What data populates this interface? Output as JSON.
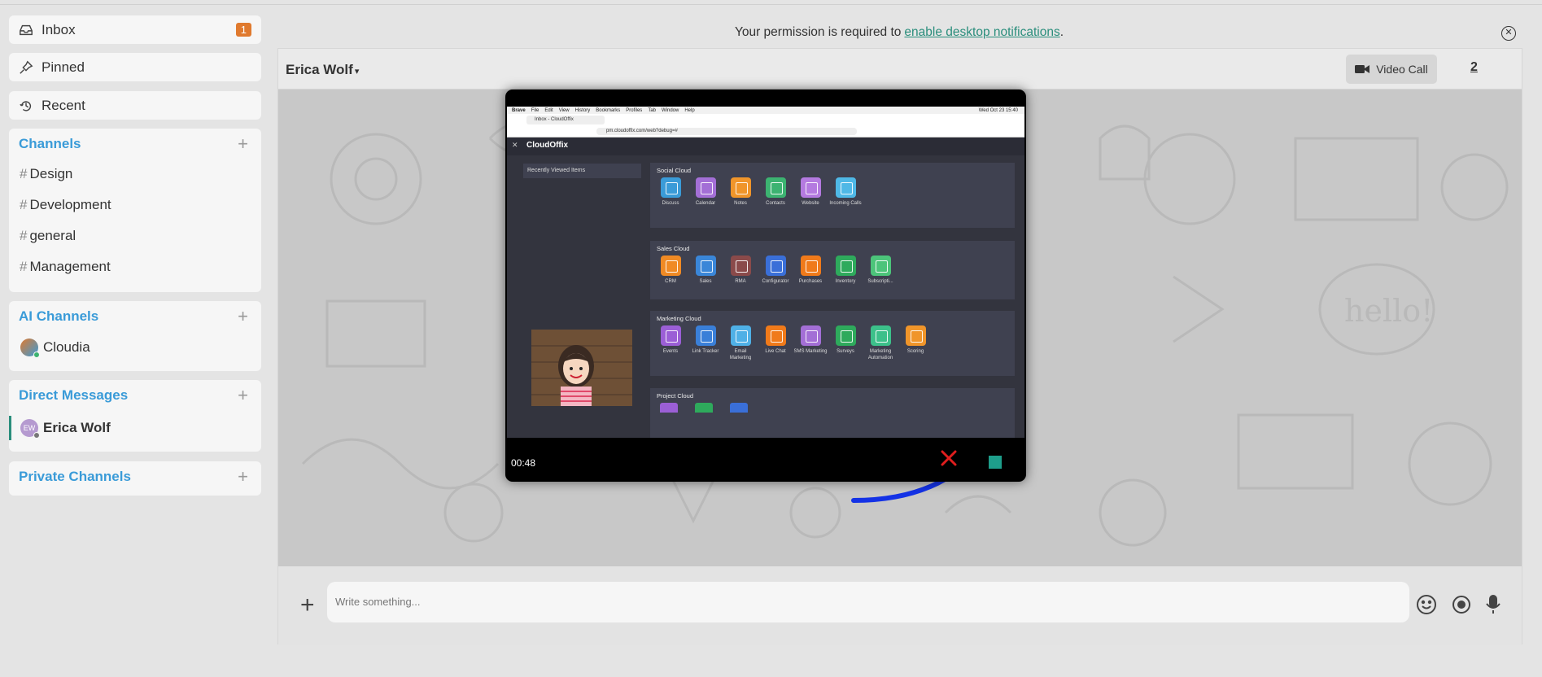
{
  "sidebar": {
    "inbox": {
      "label": "Inbox",
      "badge": "1"
    },
    "pinned": {
      "label": "Pinned"
    },
    "recent": {
      "label": "Recent"
    },
    "channels": {
      "title": "Channels",
      "items": [
        "Design",
        "Development",
        "general",
        "Management"
      ]
    },
    "ai_channels": {
      "title": "AI Channels",
      "items": [
        "Cloudia"
      ]
    },
    "direct_messages": {
      "title": "Direct Messages",
      "items": [
        {
          "name": "Erica Wolf",
          "initials": "EW"
        }
      ]
    },
    "private_channels": {
      "title": "Private Channels"
    }
  },
  "notification": {
    "text": "Your permission is required to",
    "link": "enable desktop notifications",
    "suffix": "."
  },
  "chat": {
    "contact_name": "Erica Wolf",
    "video_call_label": "Video Call",
    "participant_count": "2"
  },
  "video_overlay": {
    "timer": "00:48",
    "shared_screen": {
      "mac_menu": [
        "Brave",
        "File",
        "Edit",
        "View",
        "History",
        "Bookmarks",
        "Profiles",
        "Tab",
        "Window",
        "Help"
      ],
      "clock": "Wed Oct 23 15:40",
      "tab_title": "Inbox - CloudOffix",
      "url": "pm.cloudoffix.com/web?debug=#",
      "brand": "CloudOffix",
      "recently_viewed": "Recently Viewed Items",
      "sections": [
        {
          "title": "Social Cloud",
          "apps": [
            "Discuss",
            "Calendar",
            "Notes",
            "Contacts",
            "Website",
            "Incoming Calls"
          ]
        },
        {
          "title": "Sales Cloud",
          "apps": [
            "CRM",
            "Sales",
            "RMA",
            "Configurator",
            "Purchases",
            "Inventory",
            "Subscripti..."
          ]
        },
        {
          "title": "Marketing Cloud",
          "apps": [
            "Events",
            "Link Tracker",
            "Email Marketing",
            "Live Chat",
            "SMS Marketing",
            "Surveys",
            "Marketing Automation",
            "Scoring"
          ]
        },
        {
          "title": "Project Cloud",
          "apps": []
        }
      ]
    }
  },
  "composer": {
    "placeholder": "Write something..."
  },
  "colors": {
    "accent_blue": "#3a9bd8",
    "badge_orange": "#e07a2e",
    "link_teal": "#2a8e7c",
    "end_call_red": "#e01e1e",
    "stop_teal": "#1e9e8b",
    "arrow_blue": "#1432e6"
  }
}
